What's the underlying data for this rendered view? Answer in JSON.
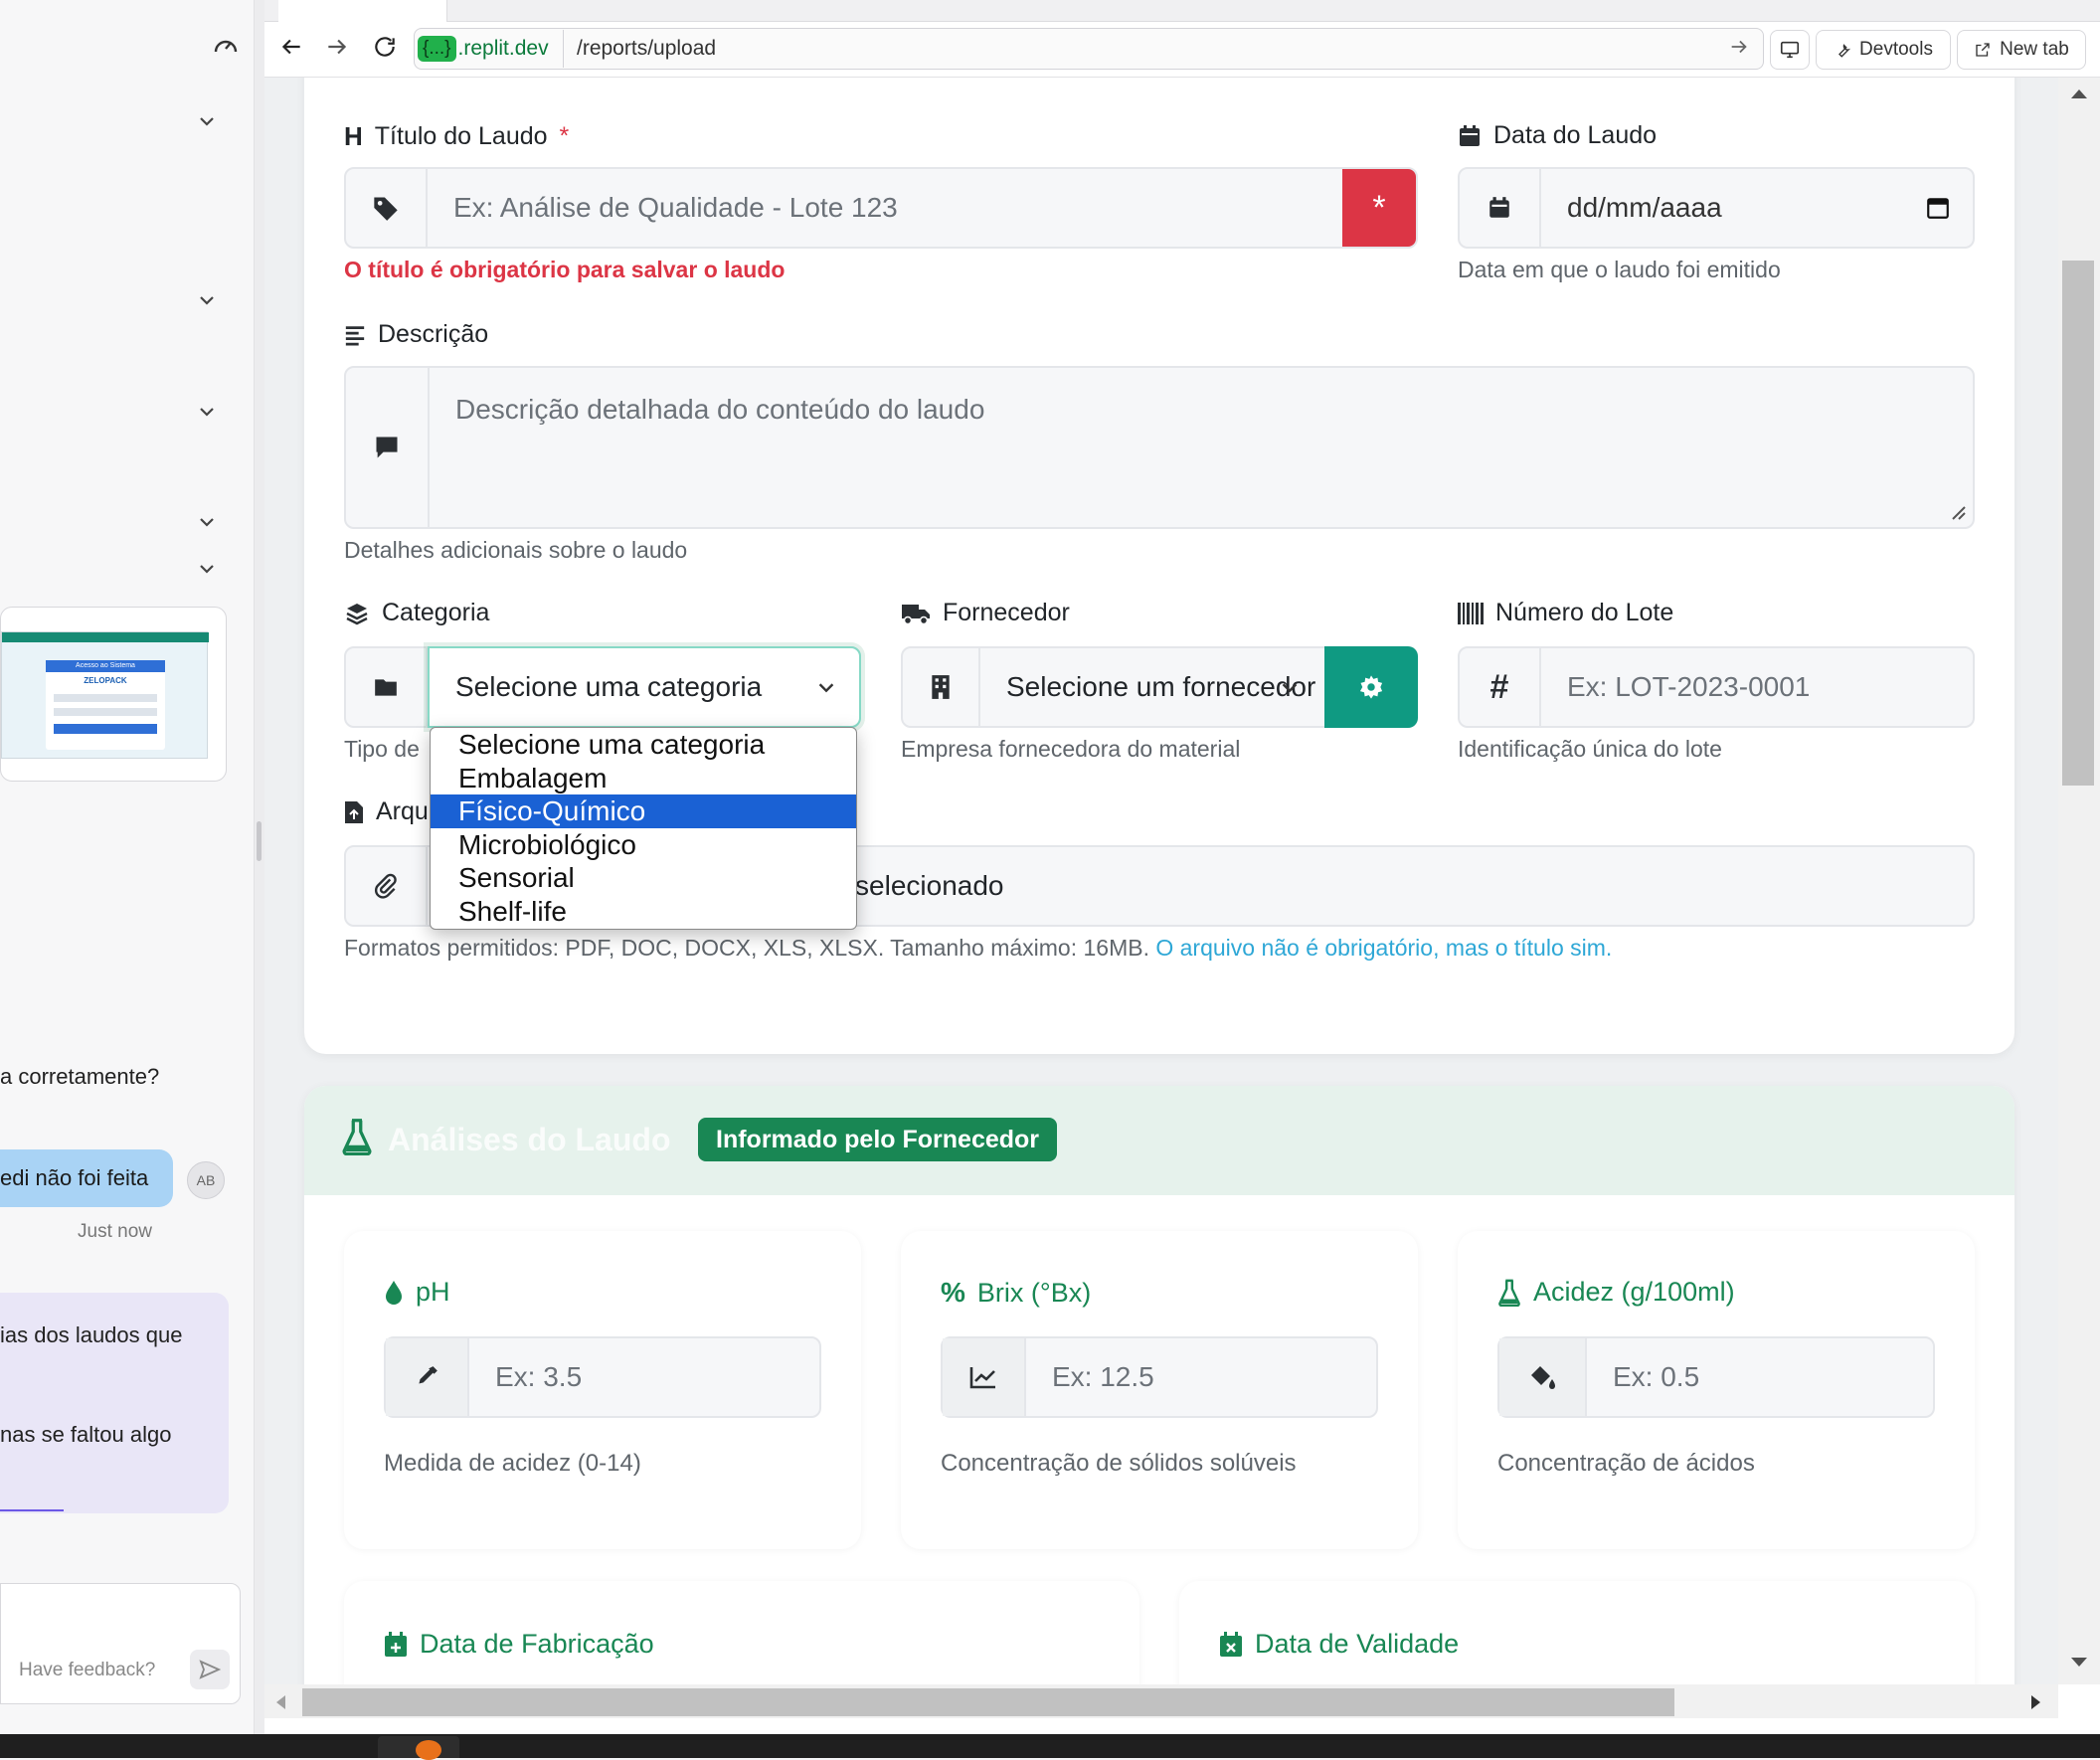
{
  "browser": {
    "url_host": ".replit.dev",
    "url_host_badge": "{...}",
    "url_path": "/reports/upload",
    "devtools_label": "Devtools",
    "new_tab_label": "New tab"
  },
  "chat": {
    "message_1": "a corretamente?",
    "user_bubble": "edi não foi feita",
    "avatar_initials": "AB",
    "timestamp": "Just now",
    "agent_line_1": "ias dos laudos que",
    "agent_line_2": "nas se faltou algo",
    "feedback_placeholder": "Have feedback?"
  },
  "thumbnail": {
    "title": "ZELOPACK",
    "button": "Acesso ao Sistema"
  },
  "form": {
    "title_label": "Título do Laudo",
    "required_mark": "*",
    "title_placeholder": "Ex: Análise de Qualidade - Lote 123",
    "title_error": "O título é obrigatório para salvar o laudo",
    "date_label": "Data do Laudo",
    "date_placeholder": "dd/mm/aaaa",
    "date_help": "Data em que o laudo foi emitido",
    "description_label": "Descrição",
    "description_placeholder": "Descrição detalhada do conteúdo do laudo",
    "description_help": "Detalhes adicionais sobre o laudo",
    "category_label": "Categoria",
    "category_selected": "Selecione uma categoria",
    "category_help": "Tipo de",
    "supplier_label": "Fornecedor",
    "supplier_selected": "Selecione um fornecedor",
    "supplier_help": "Empresa fornecedora do material",
    "lot_label": "Número do Lote",
    "lot_placeholder": "Ex: LOT-2023-0001",
    "lot_help": "Identificação única do lote",
    "file_label": "Arqu",
    "file_status": "heiro selecionado",
    "file_help": "Formatos permitidos: PDF, DOC, DOCX, XLS, XLSX. Tamanho máximo: 16MB.",
    "file_note": "O arquivo não é obrigatório, mas o título sim."
  },
  "category_options": [
    "Selecione uma categoria",
    "Embalagem",
    "Físico-Químico",
    "Microbiológico",
    "Sensorial",
    "Shelf-life"
  ],
  "category_highlighted_index": 2,
  "analyses": {
    "title": "Análises do Laudo",
    "badge": "Informado pelo Fornecedor",
    "ph_label": "pH",
    "ph_placeholder": "Ex: 3.5",
    "ph_help": "Medida de acidez (0-14)",
    "brix_label": "Brix (°Bx)",
    "brix_placeholder": "Ex: 12.5",
    "brix_help": "Concentração de sólidos solúveis",
    "acidity_label": "Acidez (g/100ml)",
    "acidity_placeholder": "Ex: 0.5",
    "acidity_help": "Concentração de ácidos",
    "manufacture_label": "Data de Fabricação",
    "expiry_label": "Data de Validade"
  },
  "colors": {
    "danger": "#dc3545",
    "success": "#198754",
    "teal": "#0f9a82",
    "selection": "#1a61d4",
    "link": "#2ea7d6"
  }
}
